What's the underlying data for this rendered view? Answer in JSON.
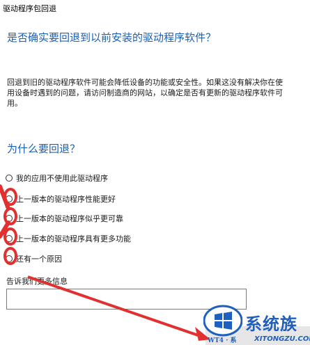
{
  "window": {
    "title": "驱动程序包回退"
  },
  "question": {
    "heading": "是否确实要回退到以前安装的驱动程序软件？",
    "description": "回退到旧的驱动程序软件可能会降低设备的功能或安全性。如果这没有解决你在使用设备时遇到的问题，请访问制造商的网站，以确定是否有更新的驱动程序软件可用。"
  },
  "reasons": {
    "heading": "为什么要回退？",
    "options": [
      "我的应用不使用此驱动程序",
      "上一版本的驱动程序性能更好",
      "上一版本的驱动程序似乎更可靠",
      "上一版本的驱动程序具有更多功能",
      "还有一个原因"
    ]
  },
  "more_info": {
    "label": "告诉我们更多信息",
    "value": ""
  },
  "watermark": {
    "brand": "系统族",
    "caption": "WT4 · 系",
    "url": "XITONGZU.COM",
    "accent": "#1f5fbf"
  },
  "annotation": {
    "arrow_color": "#e03030"
  }
}
